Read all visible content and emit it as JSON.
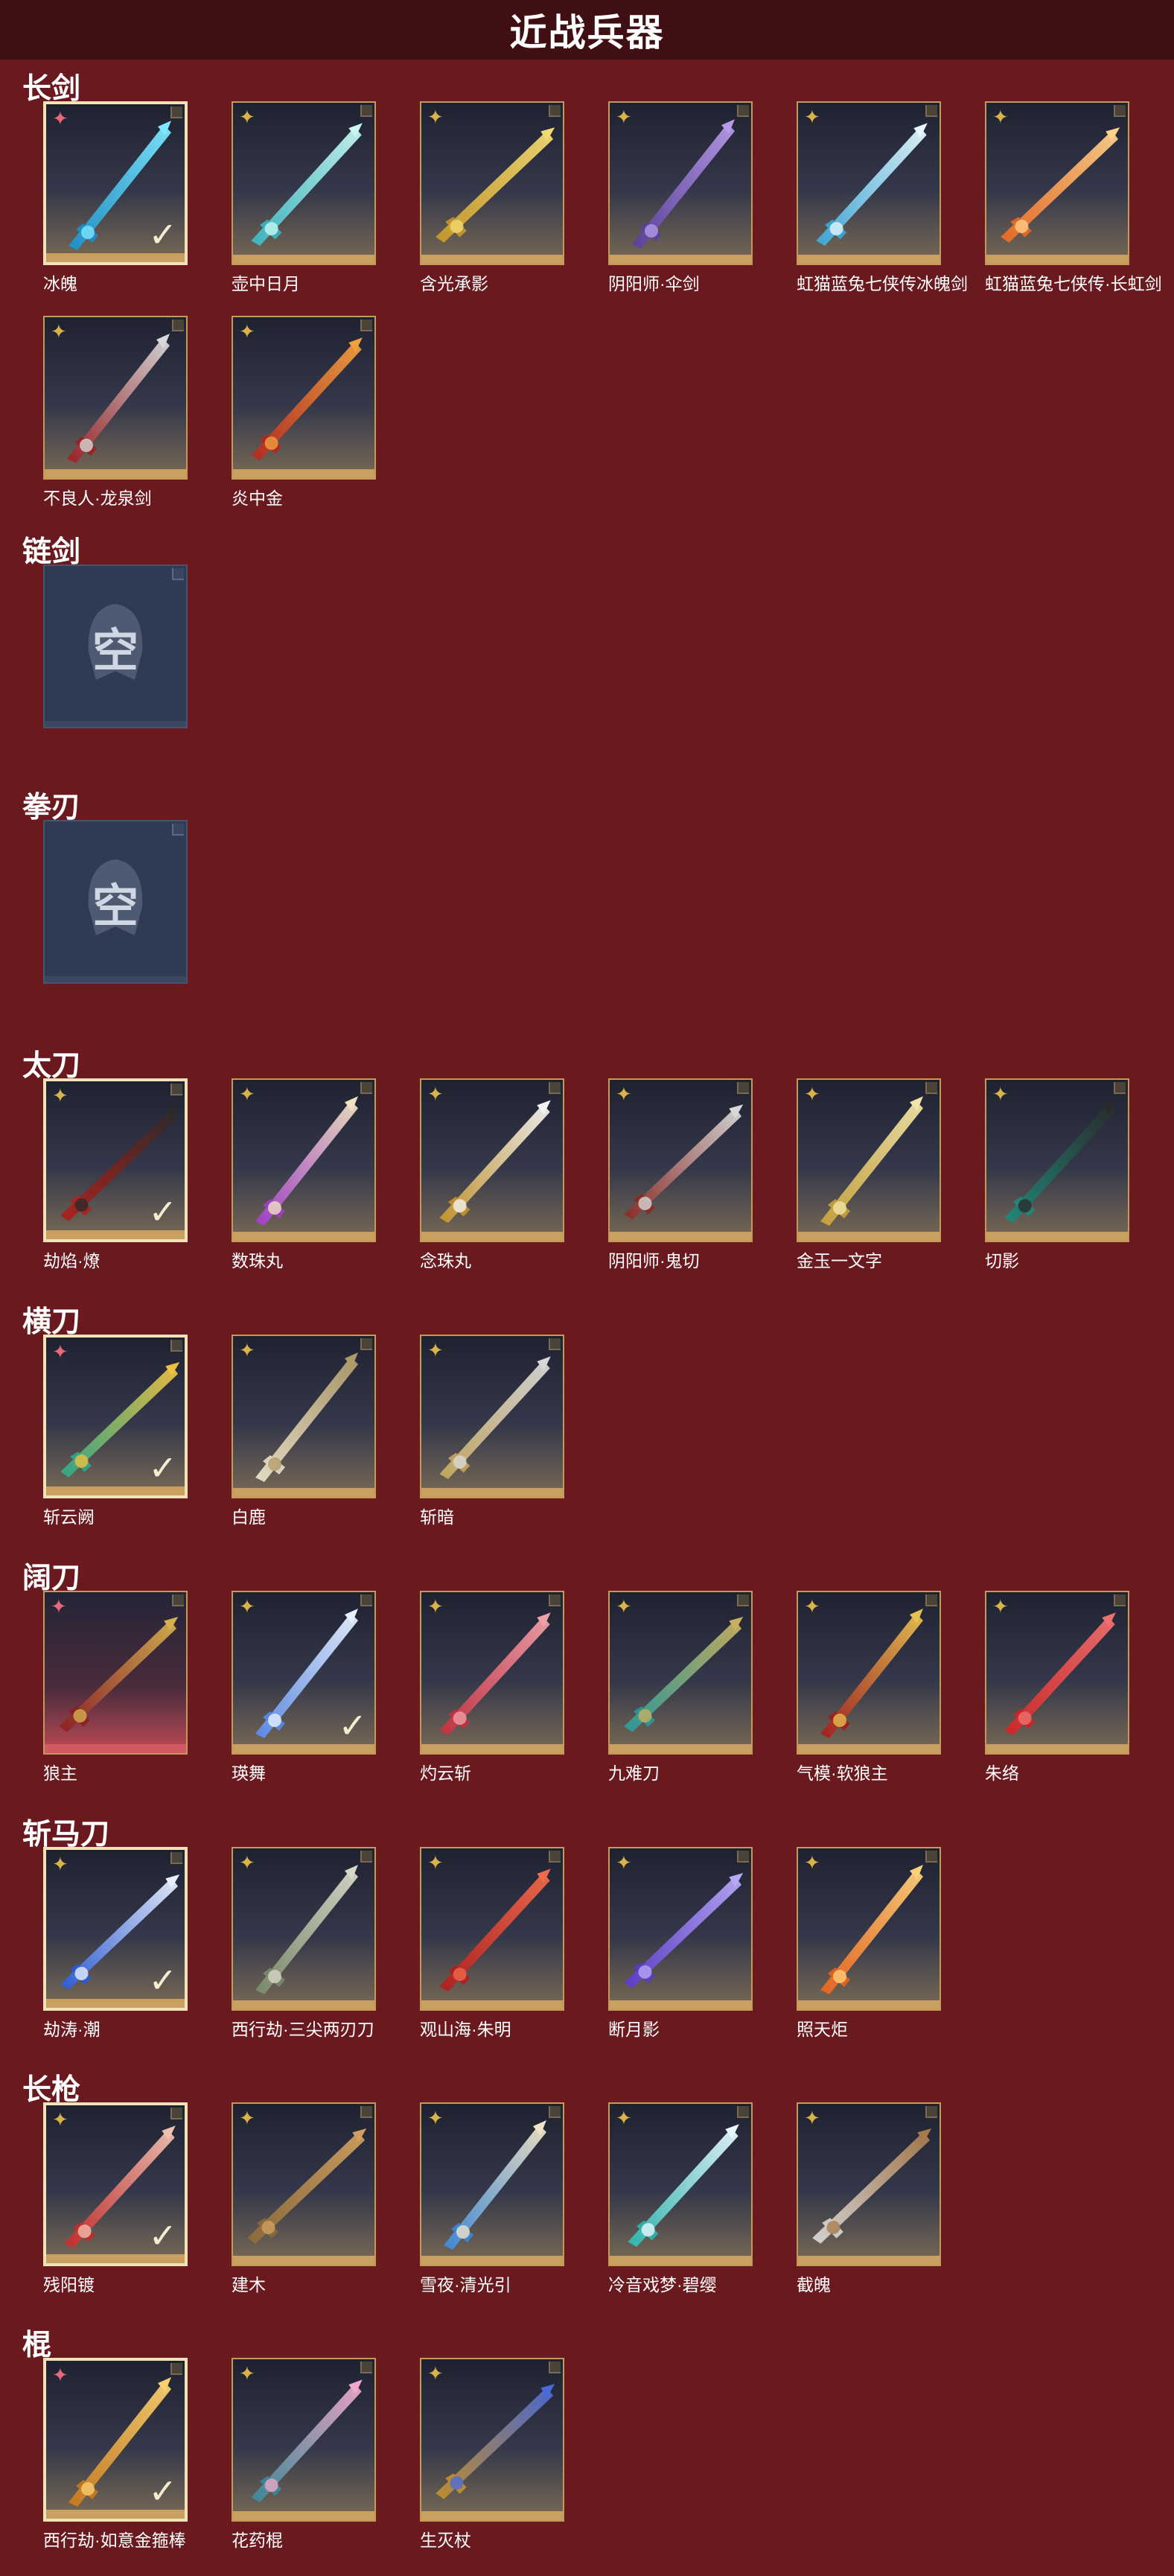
{
  "header": {
    "title": "近战兵器"
  },
  "sections": [
    {
      "title": "长剑",
      "items": [
        {
          "name": "冰魄",
          "star": "pink",
          "selected": true,
          "checked": true,
          "colors": [
            "#1d8fc8",
            "#7ee8ff"
          ]
        },
        {
          "name": "壶中日月",
          "star": "gold",
          "colors": [
            "#39b7c2",
            "#c8f7f2"
          ]
        },
        {
          "name": "含光承影",
          "star": "gold",
          "colors": [
            "#c79a2a",
            "#f2da72"
          ]
        },
        {
          "name": "阴阳师·伞剑",
          "star": "gold",
          "colors": [
            "#5a3f9a",
            "#b79ae8"
          ]
        },
        {
          "name": "虹猫蓝兔七侠传冰魄剑",
          "star": "gold",
          "colors": [
            "#3aa8d8",
            "#e6f8ff"
          ]
        },
        {
          "name": "虹猫蓝兔七侠传·长虹剑",
          "star": "gold",
          "colors": [
            "#e86a24",
            "#ffd08a"
          ]
        },
        {
          "name": "不良人·龙泉剑",
          "star": "gold",
          "colors": [
            "#9a1f24",
            "#d8d8d8"
          ]
        },
        {
          "name": "炎中金",
          "star": "gold",
          "colors": [
            "#b4281e",
            "#f0a040"
          ]
        }
      ]
    },
    {
      "title": "链剑",
      "items": [
        {
          "name": "",
          "empty": true,
          "empty_text": "空"
        }
      ]
    },
    {
      "title": "拳刃",
      "items": [
        {
          "name": "",
          "empty": true,
          "empty_text": "空"
        }
      ]
    },
    {
      "title": "太刀",
      "items": [
        {
          "name": "劫焰·燎",
          "star": "gold",
          "selected": true,
          "checked": true,
          "colors": [
            "#b0201c",
            "#2a2a2a"
          ]
        },
        {
          "name": "数珠丸",
          "star": "gold",
          "colors": [
            "#a23ccc",
            "#f0e2c0"
          ]
        },
        {
          "name": "念珠丸",
          "star": "gold",
          "colors": [
            "#c4952a",
            "#f3f3f3"
          ]
        },
        {
          "name": "阴阳师·鬼切",
          "star": "gold",
          "colors": [
            "#8a2a24",
            "#d8d8d8"
          ]
        },
        {
          "name": "金玉一文字",
          "star": "gold",
          "colors": [
            "#c7a33a",
            "#f1e4a8"
          ]
        },
        {
          "name": "切影",
          "star": "gold",
          "colors": [
            "#1e8a7a",
            "#2a2a2a"
          ]
        }
      ]
    },
    {
      "title": "横刀",
      "items": [
        {
          "name": "斩云阙",
          "star": "pink",
          "selected": true,
          "checked": true,
          "colors": [
            "#2ea88a",
            "#f0c040"
          ]
        },
        {
          "name": "白鹿",
          "star": "gold",
          "colors": [
            "#e8e0c8",
            "#b09a6a"
          ]
        },
        {
          "name": "斩暗",
          "star": "gold",
          "colors": [
            "#c4a860",
            "#d8d8d8"
          ]
        }
      ]
    },
    {
      "title": "阔刀",
      "items": [
        {
          "name": "狼主",
          "star": "pink",
          "red": true,
          "colors": [
            "#8a1f24",
            "#d4b050"
          ]
        },
        {
          "name": "瑛舞",
          "star": "gold",
          "checked": true,
          "colors": [
            "#5a8ae8",
            "#e8f2ff"
          ]
        },
        {
          "name": "灼云斩",
          "star": "gold",
          "colors": [
            "#c43040",
            "#f0a0a8"
          ]
        },
        {
          "name": "九难刀",
          "star": "gold",
          "colors": [
            "#2a9a9a",
            "#c8b060"
          ]
        },
        {
          "name": "气模·软狼主",
          "star": "gold",
          "colors": [
            "#a01e1e",
            "#e8c050"
          ]
        },
        {
          "name": "朱络",
          "star": "gold",
          "colors": [
            "#d02424",
            "#f07070"
          ]
        }
      ]
    },
    {
      "title": "斩马刀",
      "items": [
        {
          "name": "劫涛·潮",
          "star": "gold",
          "selected": true,
          "checked": true,
          "colors": [
            "#2a5ad8",
            "#e8f0ff"
          ]
        },
        {
          "name": "西行劫·三尖两刃刀",
          "star": "gold",
          "colors": [
            "#7a8a6a",
            "#d8d8c8"
          ]
        },
        {
          "name": "观山海·朱明",
          "star": "gold",
          "colors": [
            "#b01e1e",
            "#f06a4a"
          ]
        },
        {
          "name": "断月影",
          "star": "gold",
          "colors": [
            "#5a3ac8",
            "#b8a8f8"
          ]
        },
        {
          "name": "照天炬",
          "star": "gold",
          "colors": [
            "#e8641e",
            "#ffd07a"
          ]
        }
      ]
    },
    {
      "title": "长枪",
      "items": [
        {
          "name": "残阳镀",
          "star": "gold",
          "selected": true,
          "checked": true,
          "colors": [
            "#c42a2a",
            "#f0c0b0"
          ]
        },
        {
          "name": "建木",
          "star": "gold",
          "colors": [
            "#8a6a3a",
            "#d0a060"
          ]
        },
        {
          "name": "雪夜·清光引",
          "star": "gold",
          "colors": [
            "#3a8ad8",
            "#f0e4c8"
          ]
        },
        {
          "name": "冷音戏梦·碧缨",
          "star": "gold",
          "colors": [
            "#2ab8b0",
            "#e8f8ff"
          ]
        },
        {
          "name": "截魄",
          "star": "gold",
          "colors": [
            "#d8d8d8",
            "#a87a4a"
          ]
        }
      ]
    },
    {
      "title": "棍",
      "items": [
        {
          "name": "西行劫·如意金箍棒",
          "star": "pink",
          "selected": true,
          "checked": true,
          "colors": [
            "#c87a1e",
            "#f8d070"
          ]
        },
        {
          "name": "花药棍",
          "star": "gold",
          "colors": [
            "#3a8a9a",
            "#f0a8c8"
          ]
        },
        {
          "name": "生灭杖",
          "star": "gold",
          "colors": [
            "#c4902a",
            "#4a6ad8"
          ]
        }
      ]
    }
  ],
  "icons": {
    "star": "star-badge-icon",
    "check": "checkmark-icon",
    "corner": "corner-tab-icon"
  }
}
